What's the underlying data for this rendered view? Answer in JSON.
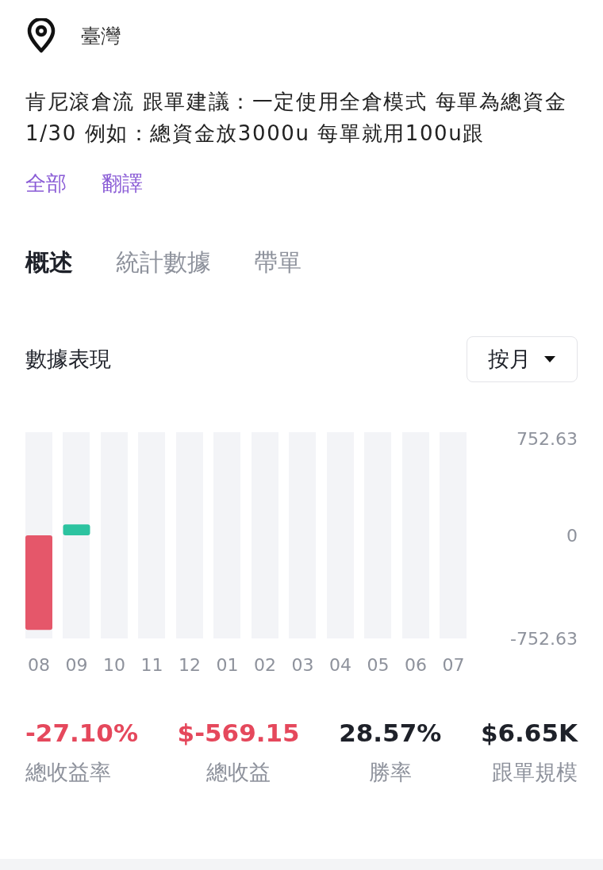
{
  "location": {
    "text": "臺灣"
  },
  "description": "肯尼滾倉流 跟單建議：一定使用全倉模式 每單為總資金1/30 例如：總資金放3000u  每單就用100u跟",
  "links": [
    "全部",
    "翻譯"
  ],
  "tabs": [
    {
      "label": "概述",
      "selected": true
    },
    {
      "label": "統計數據",
      "selected": false
    },
    {
      "label": "帶單",
      "selected": false
    }
  ],
  "performance": {
    "title": "數據表現",
    "period_dropdown": {
      "value": "按月"
    },
    "chart_data": {
      "type": "bar",
      "categories": [
        "08",
        "09",
        "10",
        "11",
        "12",
        "01",
        "02",
        "03",
        "04",
        "05",
        "06",
        "07"
      ],
      "series": [
        {
          "values": [
            -690,
            80,
            0,
            0,
            0,
            0,
            0,
            0,
            0,
            0,
            0,
            0
          ]
        }
      ],
      "ylim": [
        -752.63,
        752.63
      ],
      "yticks": [
        {
          "value": 752.63,
          "label": "752.63"
        },
        {
          "value": 0,
          "label": "0"
        },
        {
          "value": -752.63,
          "label": "-752.63"
        }
      ]
    }
  },
  "stats": [
    {
      "value": "-27.10%",
      "label": "總收益率",
      "color": "#e5485c"
    },
    {
      "value": "$-569.15",
      "label": "總收益",
      "color": "#e5485c"
    },
    {
      "value": "28.57%",
      "label": "勝率",
      "color": "#1e2129"
    },
    {
      "value": "$6.65K",
      "label": "跟單規模",
      "color": "#1e2129"
    }
  ]
}
